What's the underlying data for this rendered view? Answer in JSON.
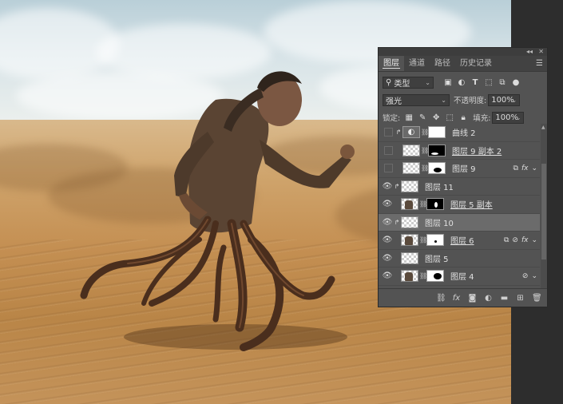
{
  "panel": {
    "tabs": [
      {
        "label": "图层",
        "active": true
      },
      {
        "label": "通道",
        "active": false
      },
      {
        "label": "路径",
        "active": false
      },
      {
        "label": "历史记录",
        "active": false
      }
    ],
    "filter": {
      "label": "类型",
      "icons": [
        "pixel-filter-icon",
        "adjustment-filter-icon",
        "type-filter-icon",
        "shape-filter-icon",
        "smart-object-filter-icon",
        "filter-toggle-icon"
      ]
    },
    "blend_mode": "强光",
    "opacity_label": "不透明度:",
    "opacity_value": "100%",
    "lock_label": "锁定:",
    "fill_label": "填充:",
    "fill_value": "100%",
    "layers": [
      {
        "name": "曲线 2",
        "visible": false,
        "clipped": true,
        "thumb": "adjustment",
        "mask": "white",
        "underlined": false,
        "selected": false
      },
      {
        "name": "图层 9 副本 2",
        "visible": false,
        "clipped": false,
        "thumb": "checker",
        "mask": "black-spot",
        "underlined": true,
        "selected": false
      },
      {
        "name": "图层 9",
        "visible": false,
        "clipped": false,
        "thumb": "checker",
        "mask": "white-spot",
        "underlined": false,
        "selected": false,
        "fx": true
      },
      {
        "name": "图层 11",
        "visible": true,
        "clipped": true,
        "thumb": "checker",
        "mask": "none",
        "underlined": false,
        "selected": false
      },
      {
        "name": "图层 5 副本",
        "visible": true,
        "clipped": false,
        "thumb": "figure",
        "mask": "black-white",
        "underlined": true,
        "selected": false
      },
      {
        "name": "图层 10",
        "visible": true,
        "clipped": true,
        "thumb": "checker",
        "mask": "none",
        "underlined": false,
        "selected": true
      },
      {
        "name": "图层 6",
        "visible": true,
        "clipped": false,
        "thumb": "figure",
        "mask": "white-dot",
        "underlined": true,
        "selected": false,
        "fx": true
      },
      {
        "name": "图层 5",
        "visible": true,
        "clipped": false,
        "thumb": "checker",
        "mask": "none",
        "underlined": false,
        "selected": false
      },
      {
        "name": "图层 4",
        "visible": true,
        "clipped": false,
        "thumb": "figure",
        "mask": "white-black",
        "underlined": false,
        "selected": false
      }
    ],
    "bottom_icons": [
      "link-layers-icon",
      "fx-icon",
      "add-mask-icon",
      "adjustment-layer-icon",
      "new-group-icon",
      "new-layer-icon",
      "delete-layer-icon"
    ],
    "fx_label": "fx"
  }
}
